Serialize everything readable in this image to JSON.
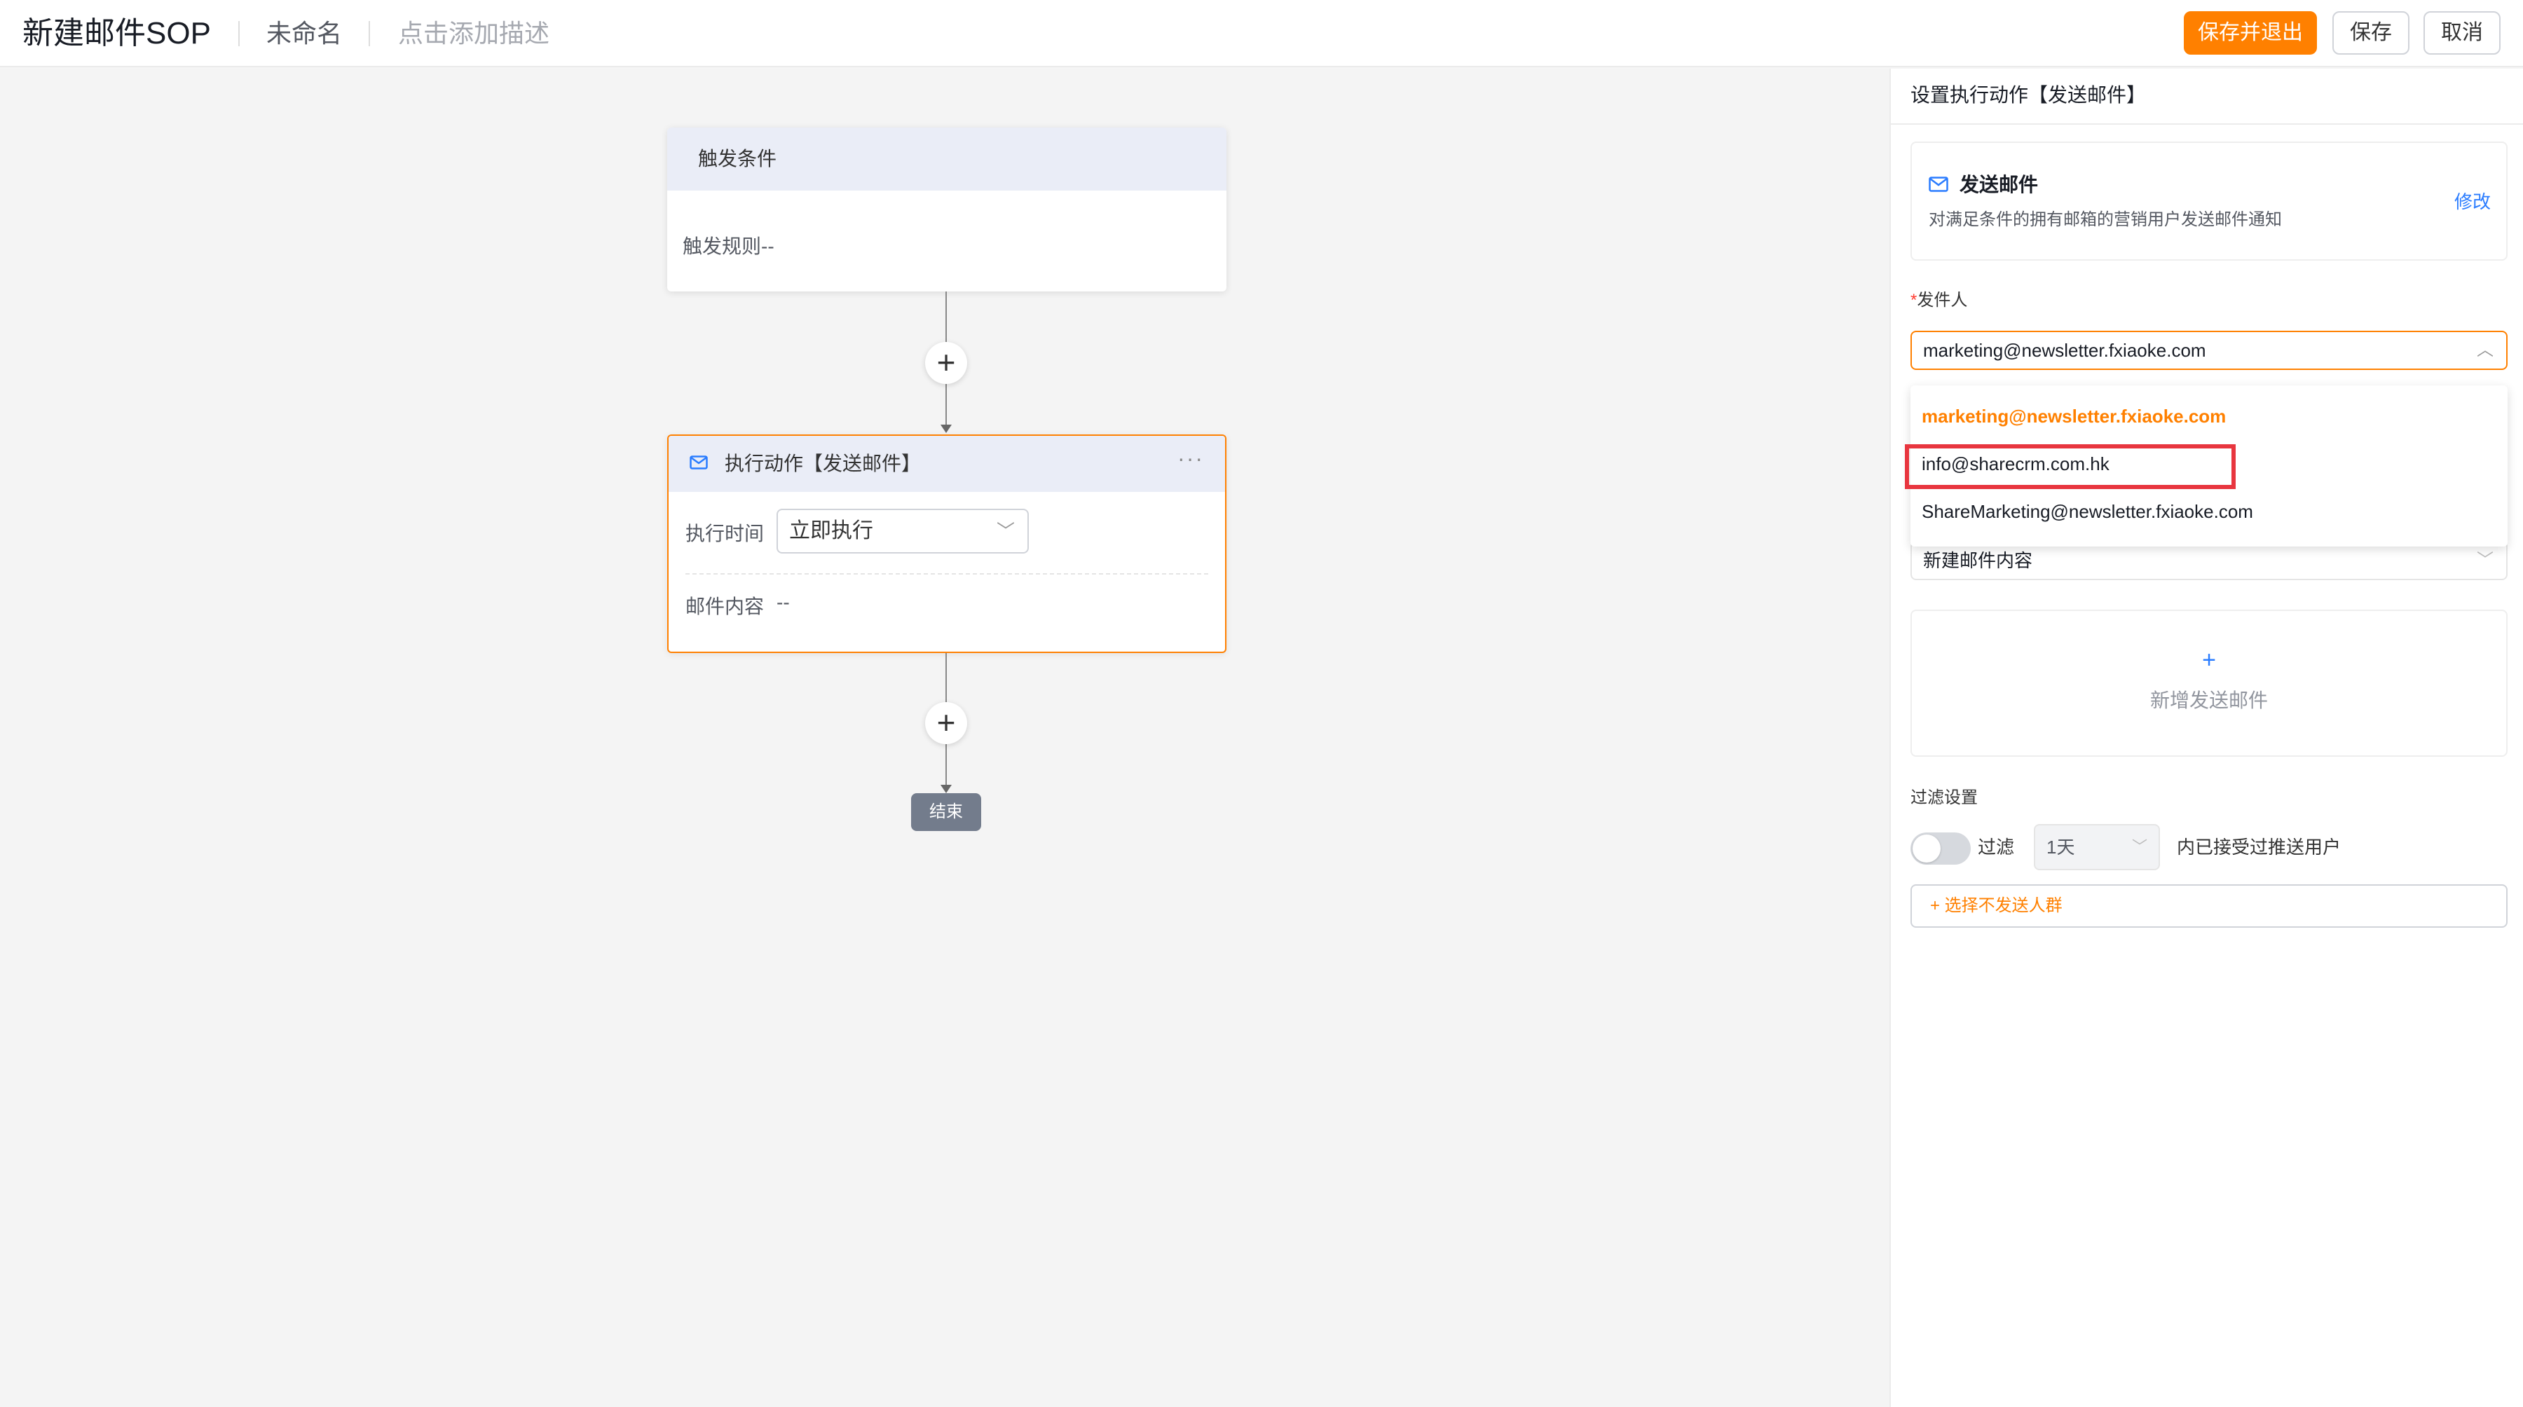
{
  "header": {
    "title": "新建邮件SOP",
    "name": "未命名",
    "description_placeholder": "点击添加描述",
    "save_exit_label": "保存并退出",
    "save_label": "保存",
    "cancel_label": "取消"
  },
  "flow": {
    "trigger": {
      "title": "触发条件",
      "rule": "触发规则--"
    },
    "action": {
      "title": "执行动作【发送邮件】",
      "more": "···",
      "exec_time_label": "执行时间",
      "exec_time_value": "立即执行",
      "mail_content_label": "邮件内容",
      "mail_content_value": "--"
    },
    "add_symbol": "+",
    "end_label": "结束"
  },
  "panel": {
    "title": "设置执行动作【发送邮件】",
    "action_info": {
      "name": "发送邮件",
      "description": "对满足条件的拥有邮箱的营销用户发送邮件通知",
      "edit_label": "修改"
    },
    "sender": {
      "required_mark": "*",
      "label": "发件人",
      "value": "marketing@newsletter.fxiaoke.com",
      "options": [
        "marketing@newsletter.fxiaoke.com",
        "info@sharecrm.com.hk",
        "ShareMarketing@newsletter.fxiaoke.com"
      ]
    },
    "mail_content_value": "新建邮件内容",
    "add_mail": {
      "plus": "+",
      "label": "新增发送邮件"
    },
    "filter": {
      "section_label": "过滤设置",
      "toggle_label": "过滤",
      "days_value": "1天",
      "suffix": "内已接受过推送用户",
      "exclude_label": "+ 选择不发送人群"
    }
  },
  "colors": {
    "accent": "#ff8000",
    "link": "#2a7cff",
    "highlight": "#e8363f"
  }
}
